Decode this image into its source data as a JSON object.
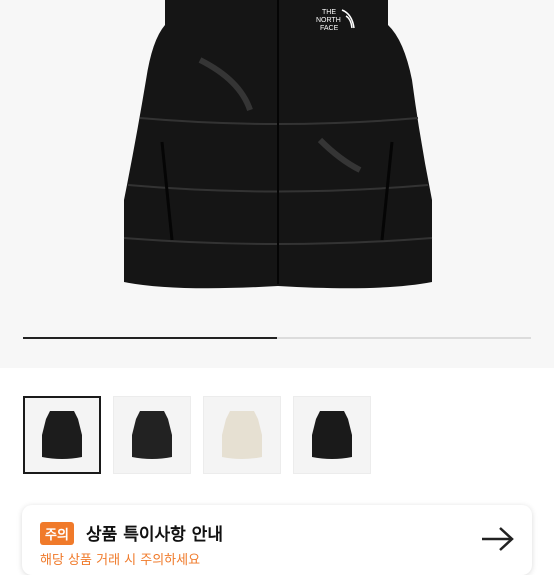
{
  "product": {
    "brand_logo_text": [
      "THE",
      "NORTH",
      "FACE"
    ],
    "image_alt": "black nuptse vest"
  },
  "gallery": {
    "progress_fraction": 0.5,
    "thumbnails": [
      {
        "color_name": "black",
        "fill": "#1c1c1c",
        "selected": true
      },
      {
        "color_name": "black-glossy",
        "fill": "#222222",
        "selected": false
      },
      {
        "color_name": "cream",
        "fill": "#e6e0d2",
        "selected": false
      },
      {
        "color_name": "black-matte",
        "fill": "#1a1a1a",
        "selected": false
      }
    ]
  },
  "notice": {
    "badge": "주의",
    "title": "상품 특이사항 안내",
    "subtitle": "해당 상품 거래 시 주의하세요"
  },
  "colors": {
    "accent": "#f07a2a",
    "background": "#f7f7f7"
  }
}
